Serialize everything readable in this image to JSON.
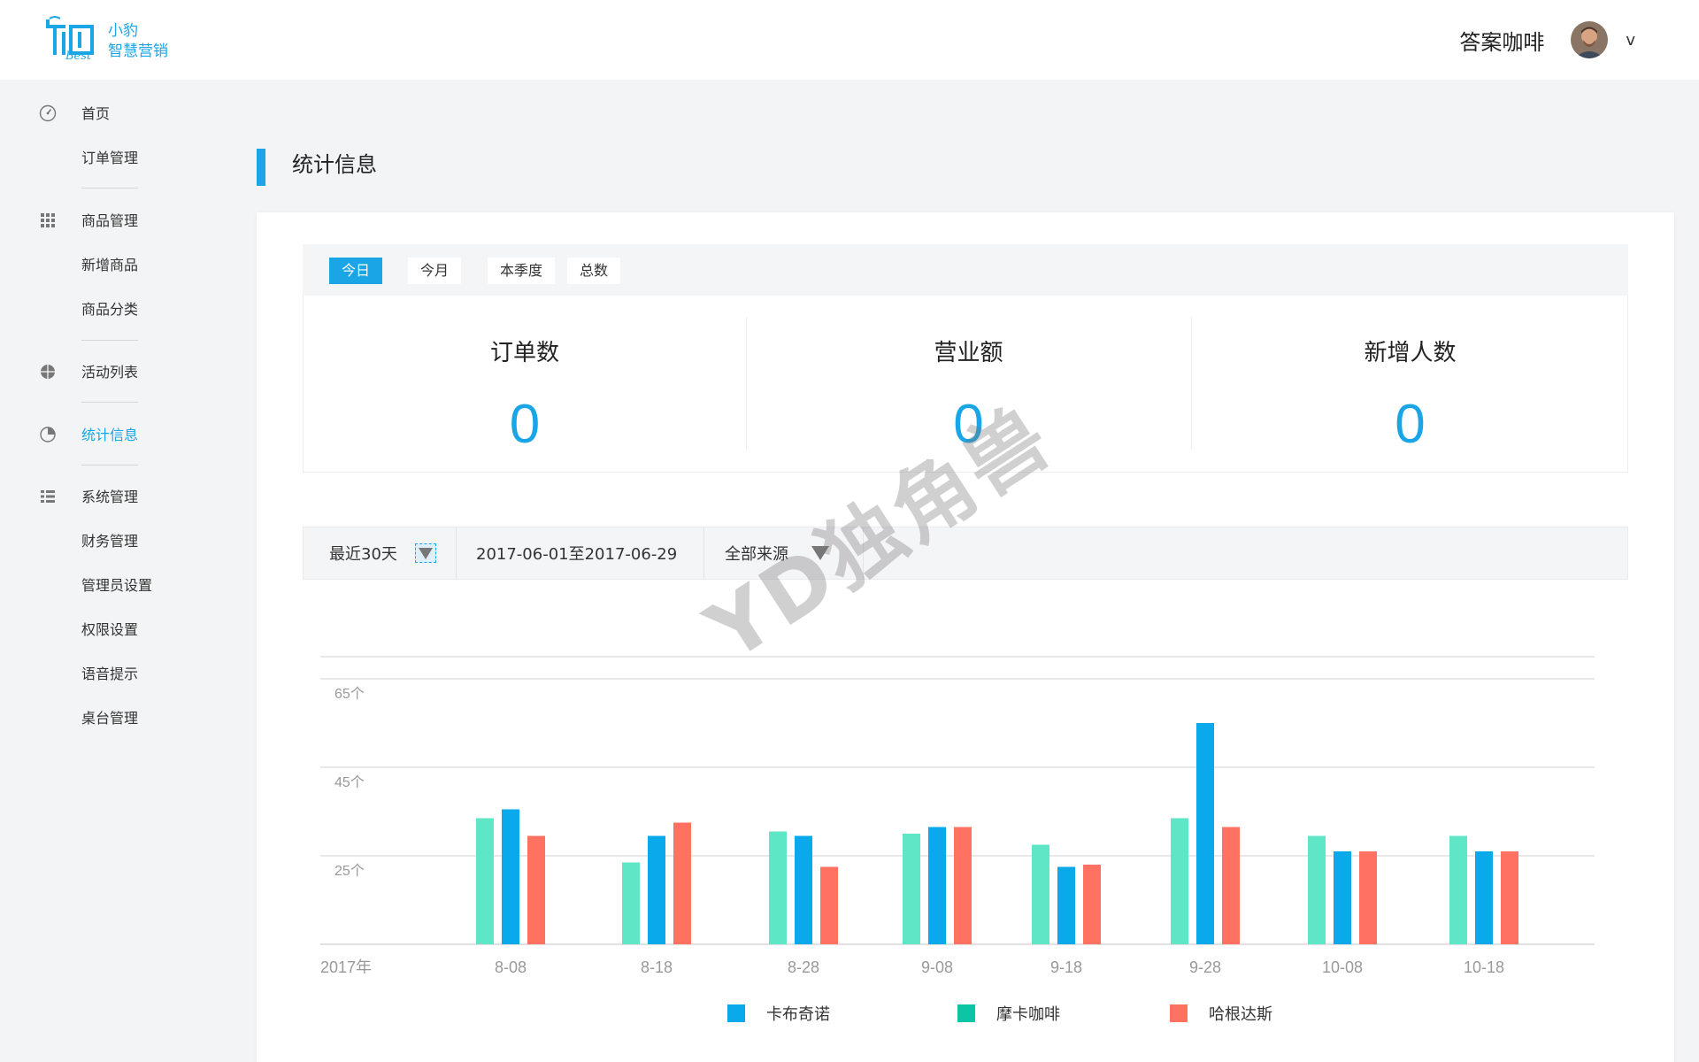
{
  "app": {
    "logo_lines": [
      "小豹",
      "智慧营销"
    ],
    "logo_sub": "Best",
    "user_name": "答案咖啡",
    "caret": "v"
  },
  "sidebar": {
    "items": [
      {
        "label": "首页",
        "icon": "dashboard-icon"
      },
      {
        "label": "订单管理",
        "icon": ""
      },
      {
        "label": "商品管理",
        "icon": "grid-icon"
      },
      {
        "label": "新增商品",
        "icon": ""
      },
      {
        "label": "商品分类",
        "icon": ""
      },
      {
        "label": "活动列表",
        "icon": "globe-icon"
      },
      {
        "label": "统计信息",
        "icon": "pie-chart-icon",
        "active": true
      },
      {
        "label": "系统管理",
        "icon": "list-icon"
      },
      {
        "label": "财务管理",
        "icon": ""
      },
      {
        "label": "管理员设置",
        "icon": ""
      },
      {
        "label": "权限设置",
        "icon": ""
      },
      {
        "label": "语音提示",
        "icon": ""
      },
      {
        "label": "桌台管理",
        "icon": ""
      }
    ]
  },
  "page": {
    "title": "统计信息"
  },
  "tabs": [
    "今日",
    "今月",
    "本季度",
    "总数"
  ],
  "active_tab": "今日",
  "stats": [
    {
      "label": "订单数",
      "value": "0"
    },
    {
      "label": "营业额",
      "value": "0"
    },
    {
      "label": "新增人数",
      "value": "0"
    }
  ],
  "filters": {
    "range": "最近30天",
    "dates": "2017-06-01至2017-06-29",
    "source": "全部来源"
  },
  "watermark": "YD独角兽",
  "colors": {
    "accent": "#1aa6e6",
    "series_1": "#0aa9ec",
    "series_2": "#5ee6c6",
    "series_3": "#ff7262"
  },
  "chart_data": {
    "type": "bar",
    "x_start_label": "2017年",
    "categories": [
      "8-08",
      "8-18",
      "8-28",
      "9-08",
      "9-18",
      "9-28",
      "10-08",
      "10-18"
    ],
    "y_ticks": [
      "25个",
      "45个",
      "65个"
    ],
    "ylim": [
      5,
      65
    ],
    "series": [
      {
        "name": "卡布奇诺",
        "values": [
          35.5,
          29.5,
          29.5,
          31.5,
          22.5,
          55,
          26,
          26
        ]
      },
      {
        "name": "摩卡咖啡",
        "values": [
          33.5,
          23.5,
          30.5,
          30,
          27.5,
          33.5,
          29.5,
          29.5
        ]
      },
      {
        "name": "哈根达斯",
        "values": [
          29.5,
          32.5,
          22.5,
          31.5,
          23,
          31.5,
          26,
          26
        ]
      }
    ],
    "grid": true,
    "legend": "bottom"
  }
}
